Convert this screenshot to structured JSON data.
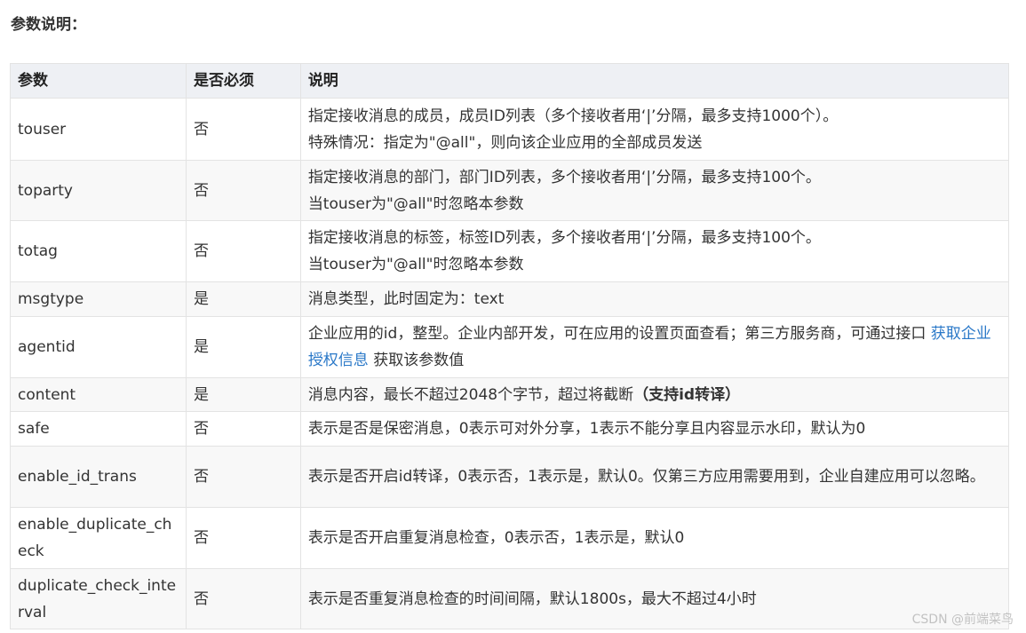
{
  "page": {
    "title": "参数说明："
  },
  "table": {
    "headers": {
      "name": "参数",
      "required": "是否必须",
      "description": "说明"
    },
    "rows": [
      {
        "name": "touser",
        "required": "否",
        "desc": [
          "指定接收消息的成员，成员ID列表（多个接收者用‘|’分隔，最多支持1000个）。",
          "特殊情况：指定为\"@all\"，则向该企业应用的全部成员发送"
        ]
      },
      {
        "name": "toparty",
        "required": "否",
        "desc": [
          "指定接收消息的部门，部门ID列表，多个接收者用‘|’分隔，最多支持100个。",
          "当touser为\"@all\"时忽略本参数"
        ]
      },
      {
        "name": "totag",
        "required": "否",
        "desc": [
          "指定接收消息的标签，标签ID列表，多个接收者用‘|’分隔，最多支持100个。",
          "当touser为\"@all\"时忽略本参数"
        ]
      },
      {
        "name": "msgtype",
        "required": "是",
        "desc": [
          "消息类型，此时固定为：text"
        ]
      },
      {
        "name": "agentid",
        "required": "是",
        "desc_pre": "企业应用的id，整型。企业内部开发，可在应用的设置页面查看；第三方服务商，可通过接口 ",
        "desc_link": "获取企业授权信息",
        "desc_post": " 获取该参数值"
      },
      {
        "name": "content",
        "required": "是",
        "desc_pre": "消息内容，最长不超过2048个字节，超过将截断",
        "desc_strong": "（支持id转译）"
      },
      {
        "name": "safe",
        "required": "否",
        "desc": [
          "表示是否是保密消息，0表示可对外分享，1表示不能分享且内容显示水印，默认为0"
        ]
      },
      {
        "name": "enable_id_trans",
        "required": "否",
        "desc": [
          "表示是否开启id转译，0表示否，1表示是，默认0。仅第三方应用需要用到，企业自建应用可以忽略。"
        ]
      },
      {
        "name": "enable_duplicate_check",
        "required": "否",
        "desc": [
          "表示是否开启重复消息检查，0表示否，1表示是，默认0"
        ]
      },
      {
        "name": "duplicate_check_interval",
        "required": "否",
        "desc": [
          "表示是否重复消息检查的时间间隔，默认1800s，最大不超过4小时"
        ]
      }
    ]
  },
  "watermark": "CSDN @前端菜鸟"
}
